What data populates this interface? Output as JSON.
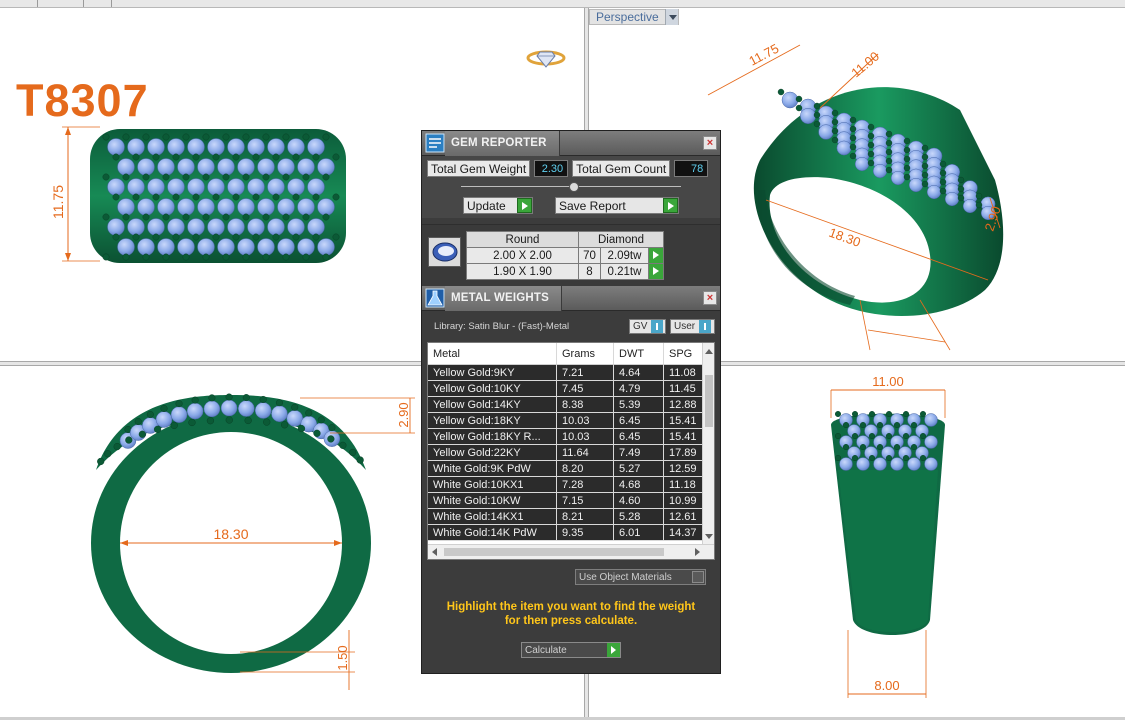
{
  "ring_code": "T8307",
  "viewport": {
    "label": "Perspective"
  },
  "dimensions": {
    "top_width_height": "11.75",
    "persp_length": "11.75",
    "persp_width": "11.00",
    "persp_band": "18.30",
    "persp_height": "2.90",
    "front_inner": "18.30",
    "front_top": "2.90",
    "front_bottom": "1.50",
    "side_top": "11.00",
    "side_bottom": "8.00"
  },
  "gem_reporter": {
    "title": "GEM REPORTER",
    "close": "×",
    "total_weight_label": "Total Gem Weight",
    "total_weight_value": "2.30",
    "total_count_label": "Total Gem Count",
    "total_count_value": "78",
    "update_label": "Update",
    "save_report_label": "Save Report",
    "col_shape": "Round",
    "col_material": "Diamond",
    "rows": [
      {
        "size": "2.00 X 2.00",
        "count": "70",
        "weight": "2.09tw"
      },
      {
        "size": "1.90 X 1.90",
        "count": "8",
        "weight": "0.21tw"
      }
    ]
  },
  "metal_weights": {
    "title": "METAL WEIGHTS",
    "close": "×",
    "library": "Library: Satin Blur - (Fast)-Metal",
    "gv_label": "GV",
    "user_label": "User",
    "headers": [
      "Metal",
      "Grams",
      "DWT",
      "SPG"
    ],
    "rows": [
      [
        "Yellow Gold:9KY",
        "7.21",
        "4.64",
        "11.08"
      ],
      [
        "Yellow Gold:10KY",
        "7.45",
        "4.79",
        "11.45"
      ],
      [
        "Yellow Gold:14KY",
        "8.38",
        "5.39",
        "12.88"
      ],
      [
        "Yellow Gold:18KY",
        "10.03",
        "6.45",
        "15.41"
      ],
      [
        "Yellow Gold:18KY R...",
        "10.03",
        "6.45",
        "15.41"
      ],
      [
        "Yellow Gold:22KY",
        "11.64",
        "7.49",
        "17.89"
      ],
      [
        "White Gold:9K PdW",
        "8.20",
        "5.27",
        "12.59"
      ],
      [
        "White Gold:10KX1",
        "7.28",
        "4.68",
        "11.18"
      ],
      [
        "White Gold:10KW",
        "7.15",
        "4.60",
        "10.99"
      ],
      [
        "White Gold:14KX1",
        "8.21",
        "5.28",
        "12.61"
      ],
      [
        "White Gold:14K PdW",
        "9.35",
        "6.01",
        "14.37"
      ]
    ],
    "use_object_materials": "Use Object Materials",
    "hint_line1": "Highlight the item you want to find the weight",
    "hint_line2": "for then press calculate.",
    "calculate_label": "Calculate"
  },
  "colors": {
    "accent_orange": "#e56a1c",
    "metal_green": "#0f6a44",
    "gem_blue": "#8aa9e8",
    "prong_green": "#0b5a36",
    "hint_yellow": "#ffc61a"
  }
}
